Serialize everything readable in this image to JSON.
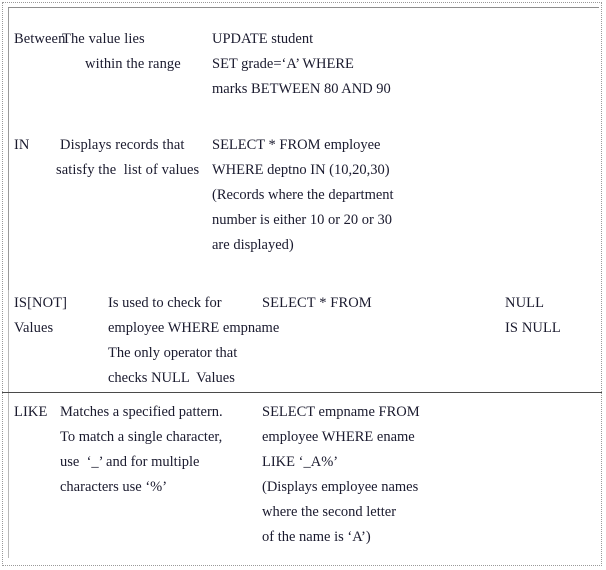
{
  "document": {
    "type": "sql-operators-table",
    "border_color": "#9a9a9a",
    "text_color": "#1a1a2e"
  },
  "rows": [
    {
      "operator": "Between",
      "description_lines": [
        "The value lies",
        "within the range"
      ],
      "example_lines": [
        "UPDATE student",
        "SET grade=‘A’ WHERE",
        "marks BETWEEN 80 AND 90"
      ],
      "extra_lines": []
    },
    {
      "operator": "IN",
      "description_lines": [
        "Displays records that",
        "satisfy the  list of values"
      ],
      "example_lines": [
        "SELECT * FROM employee",
        "WHERE deptno IN (10,20,30)",
        "(Records where the department",
        "number is either 10 or 20 or 30",
        "are displayed)"
      ],
      "extra_lines": []
    },
    {
      "operator": "IS[NOT]",
      "operator_line2": "Values",
      "description_lines": [
        "Is used to check for",
        "employee WHERE empname",
        "The only operator that",
        "checks NULL  Values"
      ],
      "example_lines": [
        "SELECT * FROM"
      ],
      "extra_lines": [
        "NULL",
        "IS NULL"
      ]
    },
    {
      "operator": "LIKE",
      "description_lines": [
        "Matches a specified pattern.",
        "To match a single character,",
        "use  ‘_’ and for multiple",
        "characters use ‘%’"
      ],
      "example_lines": [
        "SELECT empname FROM",
        "employee WHERE ename",
        "LIKE ‘_A%’",
        "(Displays employee names",
        "where the second letter",
        "of the name is ‘A’)"
      ],
      "extra_lines": []
    }
  ]
}
